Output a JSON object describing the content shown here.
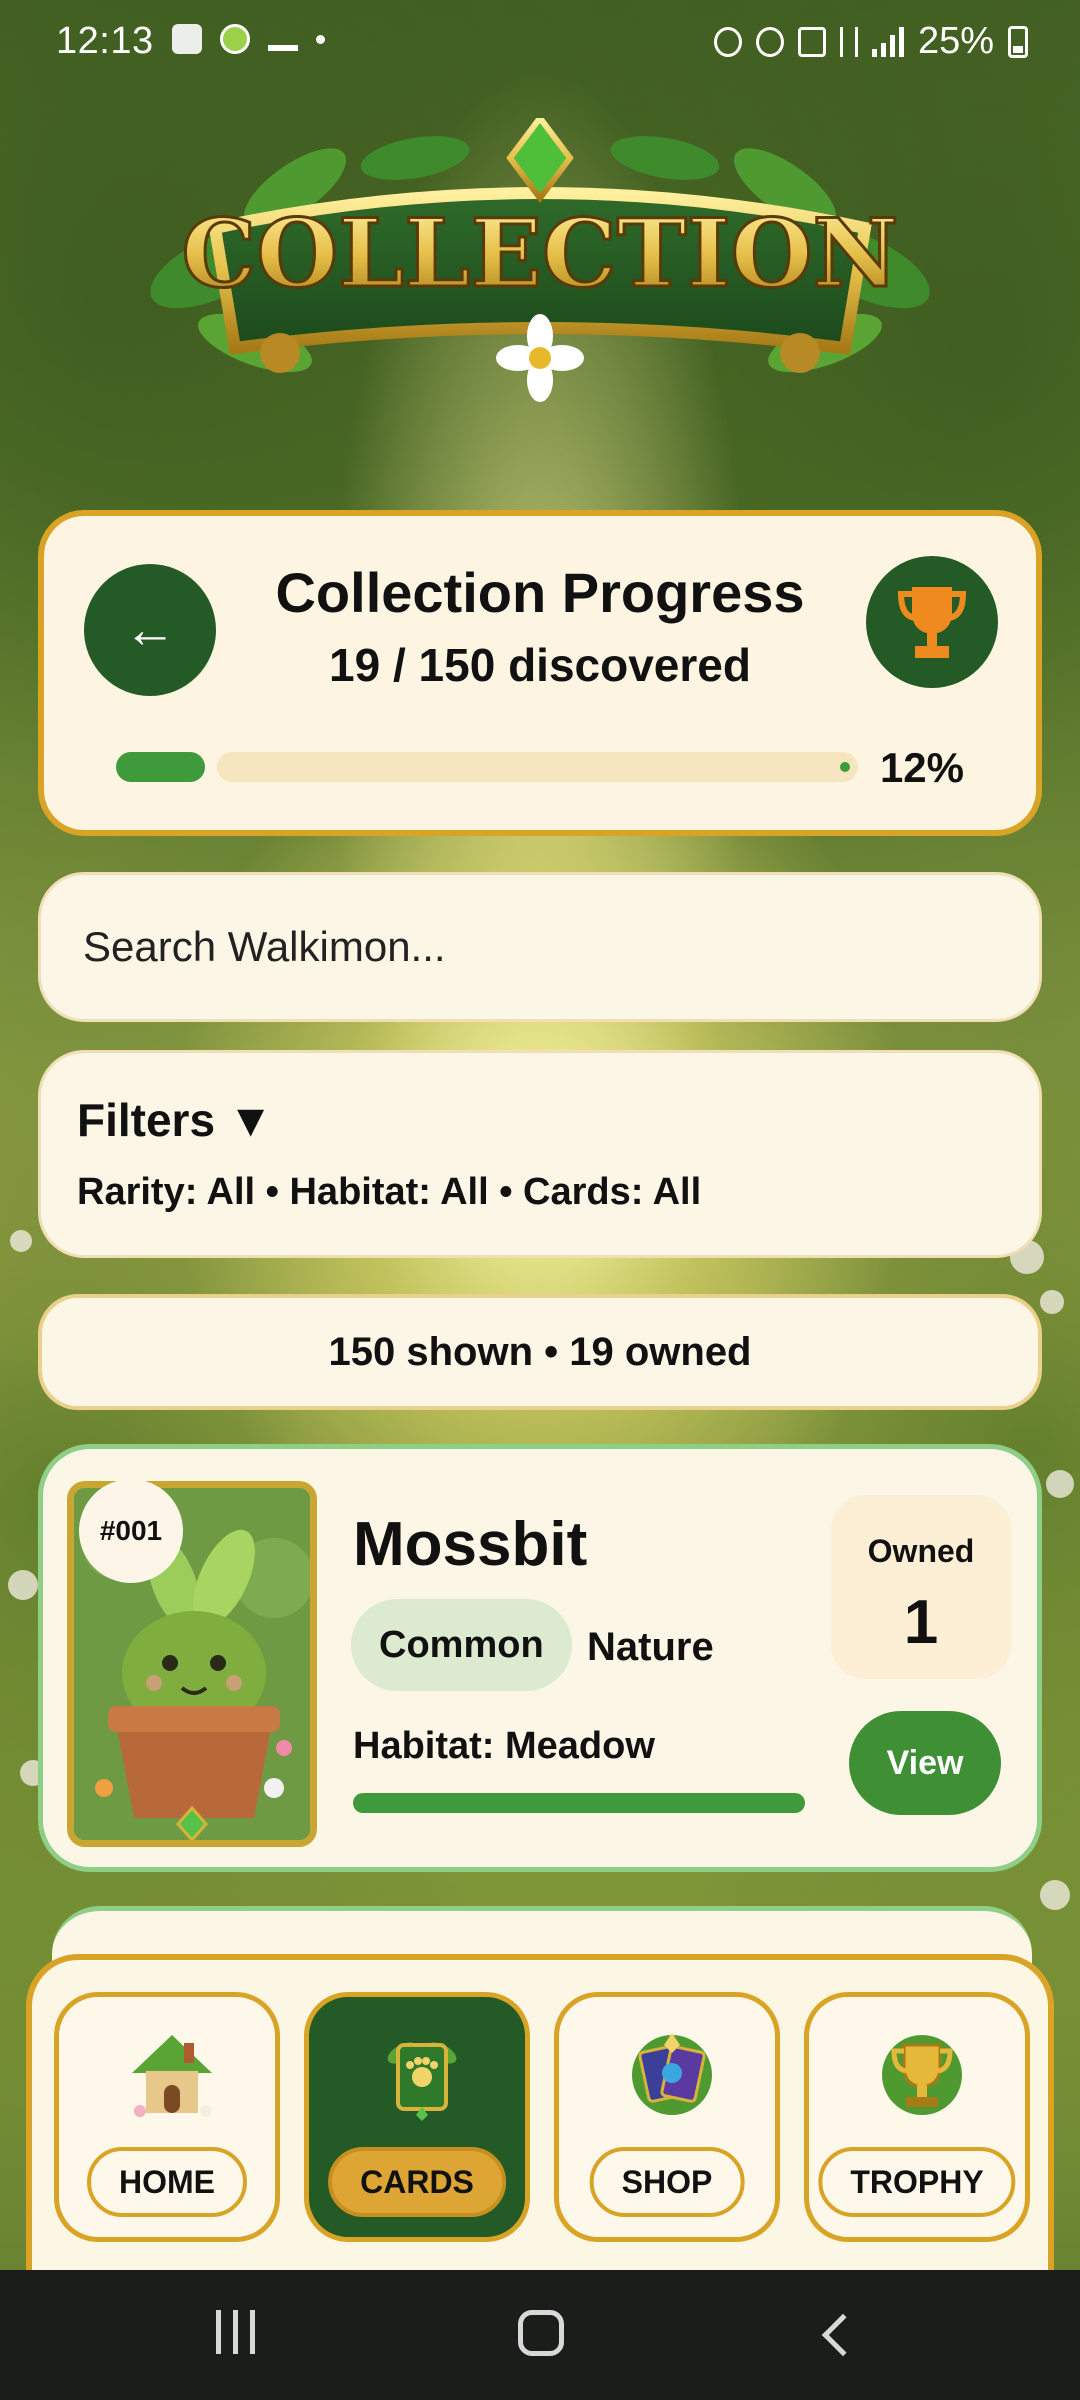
{
  "status_bar": {
    "time": "12:13",
    "battery": "25%"
  },
  "banner": {
    "title": "COLLECTION"
  },
  "progress": {
    "title": "Collection Progress",
    "discovered_text": "19 / 150 discovered",
    "percent_label": "12%",
    "fraction": 0.12
  },
  "search": {
    "placeholder": "Search Walkimon..."
  },
  "filters": {
    "title": "Filters ▼",
    "summary": "Rarity: All • Habitat: All • Cards: All"
  },
  "results": {
    "summary": "150 shown • 19 owned"
  },
  "cards": [
    {
      "number": "#001",
      "name": "Mossbit",
      "rarity": "Common",
      "type": "Nature",
      "habitat": "Habitat: Meadow",
      "owned_label": "Owned",
      "owned_count": "1",
      "view_label": "View"
    }
  ],
  "bottom_nav": [
    {
      "label": "HOME",
      "icon": "cottage-icon",
      "active": false
    },
    {
      "label": "CARDS",
      "icon": "card-deck-icon",
      "active": true
    },
    {
      "label": "SHOP",
      "icon": "card-packs-icon",
      "active": false
    },
    {
      "label": "TROPHY",
      "icon": "trophy-icon",
      "active": false
    }
  ],
  "colors": {
    "dark_green": "#245a26",
    "gold": "#d9a425",
    "cream": "#fcf6e6",
    "progress_green": "#3e9a3a"
  }
}
